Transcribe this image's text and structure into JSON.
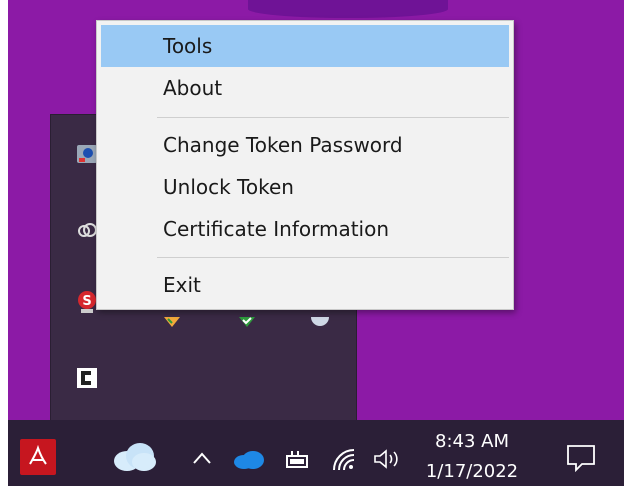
{
  "context_menu": {
    "items": [
      {
        "label": "Tools",
        "highlighted": true
      },
      {
        "label": "About"
      },
      {
        "label": "Change Token Password"
      },
      {
        "label": "Unlock Token"
      },
      {
        "label": "Certificate Information"
      },
      {
        "label": "Exit"
      }
    ]
  },
  "taskbar": {
    "time": "8:43 AM",
    "date": "1/17/2022"
  },
  "colors": {
    "wallpaper": "#8c1aa6",
    "taskbar": "#2b1f37",
    "menu_highlight": "#99c9f4",
    "acrobat_red": "#c6161f"
  },
  "icons": [
    "token-app-icon",
    "creative-cloud-icon",
    "security-s-icon",
    "shield-check-icon",
    "c-app-icon",
    "acrobat-icon",
    "weather-cloud-icon",
    "chevron-up-icon",
    "onedrive-icon",
    "battery-icon",
    "wifi-icon",
    "speaker-icon",
    "notification-icon"
  ]
}
